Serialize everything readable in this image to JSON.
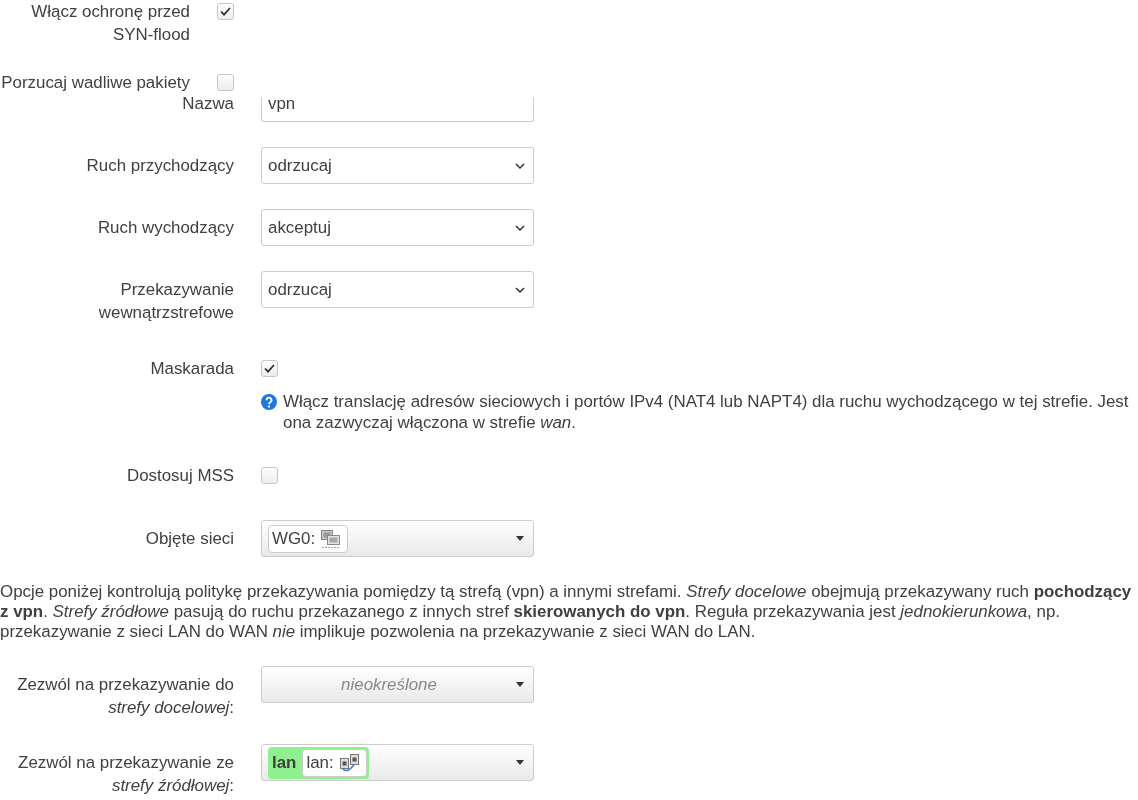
{
  "upper_rows": [
    {
      "kind": "checkbox",
      "label": "Włącz ochronę przed SYN-flood",
      "checked": true
    },
    {
      "kind": "checkbox",
      "label": "Porzucaj wadliwe pakiety",
      "checked": false
    }
  ],
  "zone_settings": [
    {
      "kind": "text",
      "label": "Nazwa",
      "value": "vpn"
    },
    {
      "kind": "select",
      "label": "Ruch przychodzący",
      "value": "odrzucaj"
    },
    {
      "kind": "select",
      "label": "Ruch wychodzący",
      "value": "akceptuj"
    },
    {
      "kind": "select",
      "label": "Przekazywanie wewnątrzstrefowe",
      "value": "odrzucaj"
    },
    {
      "kind": "checkbox",
      "label": "Maskarada",
      "checked": true,
      "help": "Włącz translację adresów sieciowych i portów IPv4 (NAT4 lub NAPT4) dla ruchu wychodzącego w tej strefie. Jest ona zazwyczaj włączona w strefie *wan*."
    },
    {
      "kind": "checkbox",
      "label": "Dostosuj MSS",
      "checked": false
    },
    {
      "kind": "dropdown",
      "label": "Objęte sieci",
      "chips": [
        {
          "kind": "tunnel",
          "label": "WG0:"
        }
      ]
    }
  ],
  "forwarding_description": "Opcje poniżej kontrolują politykę przekazywania pomiędzy tą strefą (vpn) a innymi strefami. *Strefy docelowe* obejmują przekazywany ruch **pochodzący z vpn**. *Strefy źródłowe* pasują do ruchu przekazanego z innych stref **skierowanych do vpn**. Reguła przekazywania jest *jednokierunkowa*, np. przekazywanie z sieci LAN do WAN *nie* implikuje pozwolenia na przekazywanie z sieci WAN do LAN.",
  "forwarding_settings": [
    {
      "kind": "dropdown",
      "label": "Zezwól na przekazywanie do *strefy docelowej*:",
      "placeholder": "nieokreślone"
    },
    {
      "kind": "dropdown",
      "label": "Zezwól na przekazywanie ze *strefy źródłowej*:",
      "chips": [
        {
          "kind": "ethernet",
          "zone": "lan",
          "color": "#90f090",
          "label": "lan:"
        }
      ]
    }
  ]
}
